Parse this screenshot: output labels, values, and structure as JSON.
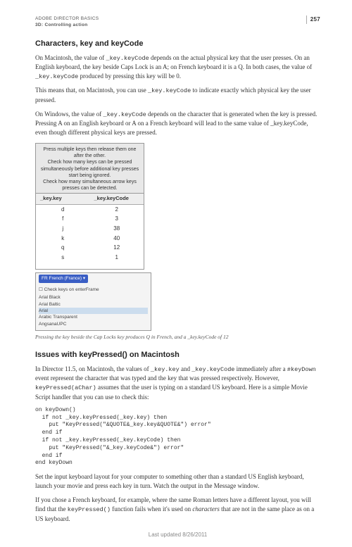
{
  "header": {
    "line1": "ADOBE DIRECTOR BASICS",
    "line2": "3D: Controlling action",
    "page_number": "257"
  },
  "section1": {
    "heading": "Characters, key and keyCode",
    "p1a": "On Macintosh, the value of ",
    "p1code1": "_key.keyCode",
    "p1b": " depends on the actual physical key that the user presses. On an English keyboard, the key beside Caps Lock is an A; on French keyboard it is a Q. In both cases, the value of ",
    "p1code2": "_key.keyCode",
    "p1c": " produced by pressing this key will be 0.",
    "p2a": "This means that, on Macintosh, you can use ",
    "p2code": "_key.keyCode",
    "p2b": " to indicate exactly which physical key the user pressed.",
    "p3a": "On Windows, the value of ",
    "p3code": "_key.keyCode",
    "p3b": " depends on the character that is generated when the key is pressed. Pressing A on an English keyboard or A on a French keyboard will lead to the same value of _key.keyCode, even though different physical keys are pressed."
  },
  "figure": {
    "msg_line1": "Press multiple keys then release them one after the other.",
    "msg_line2": "Check how many keys can be pressed simultaneously before additional key presses start being ignored.",
    "msg_line3": "Check how many simultaneous arrow keys presses can be detected.",
    "col1": "_key.key",
    "col2": "_key.keyCode",
    "rows": [
      {
        "key": "d",
        "code": "2"
      },
      {
        "key": "f",
        "code": "3"
      },
      {
        "key": "j",
        "code": "38"
      },
      {
        "key": "k",
        "code": "40"
      },
      {
        "key": "q",
        "code": "12"
      },
      {
        "key": "s",
        "code": "1"
      }
    ],
    "dropdown": "FR French (France) ▾",
    "checkbox": "Check keys on enterFrame",
    "font_rows": [
      "Arial Black",
      "Arial Baltic",
      "Arial",
      "Arabic Transparent",
      "AngsanaUPC"
    ],
    "caption": "Pressing the key beside the Cap Locks key produces Q in French, and a _key.keyCode of 12"
  },
  "section2": {
    "heading": "Issues with keyPressed() on Macintosh",
    "p1a": "In Director 11.5, on Macintosh, the values of ",
    "p1code1": "_key.key",
    "p1b": " and ",
    "p1code2": "_key.keyCode",
    "p1c": " immediately after a ",
    "p1code3": "#keyDown",
    "p1d": " event represent the character that was typed and the key that was pressed respectively. However, ",
    "p1code4": "keyPressed(aChar)",
    "p1e": " assumes that the user is typing on a standard US keyboard. Here is a simple Movie Script handler that you can use to check this:",
    "code": "on keyDown()\n  if not _key.keyPressed(_key.key) then\n    put \"KeyPressed(\"&QUOTE&_key.key&QUOTE&\") error\"\n  end if\n  if not _key.keyPressed(_key.keyCode) then\n    put \"KeyPressed(\"&_key.keyCode&\") error\"\n  end if\nend keyDown",
    "p2": "Set the input keyboard layout for your computer to something other than a standard US English keyboard, launch your movie and press each key in turn. Watch the output in the Message window.",
    "p3a": "If you chose a French keyboard, for example, where the same Roman letters have a different layout, you will find that the ",
    "p3code": "keyPressed()",
    "p3b": " function fails when it's used on ",
    "p3i": "characters",
    "p3c": " that are not in the same place as on a US keyboard."
  },
  "footer": "Last updated 8/26/2011"
}
